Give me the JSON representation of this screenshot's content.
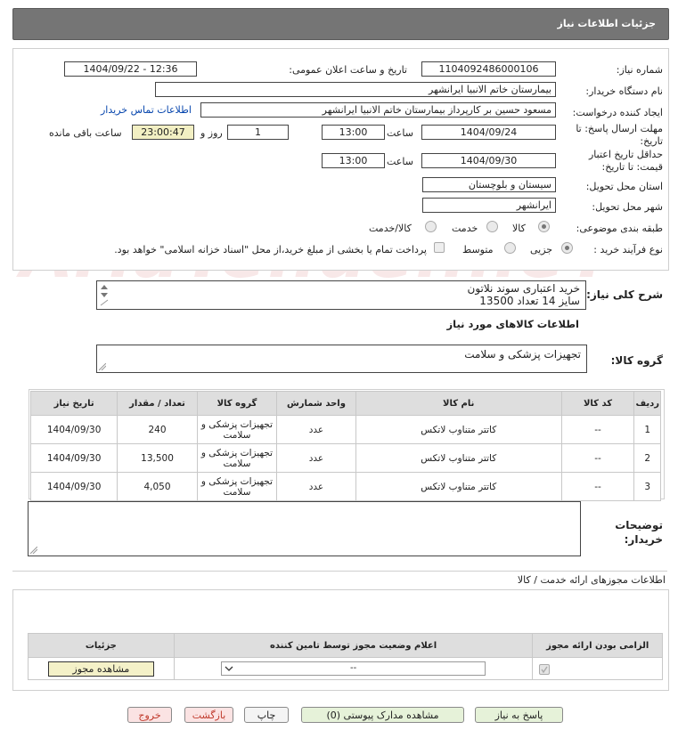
{
  "header": {
    "title": "جزئیات اطلاعات نیاز"
  },
  "form": {
    "need_number_label": "شماره نیاز:",
    "need_number": "1104092486000106",
    "announce_label": "تاریخ و ساعت اعلان عمومی:",
    "announce_value": "1404/09/22 - 12:36",
    "buyer_org_label": "نام دستگاه خریدار:",
    "buyer_org": "بیمارستان خاتم الانبیا ایرانشهر",
    "creator_label": "ایجاد کننده درخواست:",
    "creator": "مسعود حسین بر کارپرداز بیمارستان خاتم الانبیا ایرانشهر",
    "contact_link": "اطلاعات تماس خریدار",
    "deadline_label_1": "مهلت ارسال پاسخ: تا",
    "deadline_label_2": "تاریخ:",
    "deadline_date": "1404/09/24",
    "time_label": "ساعت",
    "deadline_time": "13:00",
    "days_value": "1",
    "days_label": "روز و",
    "remaining_time": "23:00:47",
    "remaining_label": "ساعت باقی مانده",
    "validity_label_1": "حداقل تاریخ اعتبار",
    "validity_label_2": "قیمت: تا تاریخ:",
    "validity_date": "1404/09/30",
    "validity_time": "13:00",
    "province_label": "استان محل تحویل:",
    "province": "سیستان و بلوچستان",
    "city_label": "شهر محل تحویل:",
    "city": "ایرانشهر",
    "category_label": "طبقه بندی موضوعی:",
    "category_options": [
      "کالا",
      "خدمت",
      "کالا/خدمت"
    ],
    "process_label": "نوع فرآیند خرید :",
    "process_options": [
      "جزیی",
      "متوسط"
    ],
    "payment_note": "پرداخت تمام یا بخشی از مبلغ خرید،از محل \"اسناد خزانه اسلامی\" خواهد بود."
  },
  "watermark": "AriaTender.neT",
  "description": {
    "label": "شرح کلی نیاز:",
    "line1": "خرید اعتباری سوند نلاتون",
    "line2": "سایز 14 تعداد 13500"
  },
  "goods": {
    "section_title": "اطلاعات کالاهای مورد نیاز",
    "group_label": "گروه کالا:",
    "group_value": "تجهیزات پزشکی و سلامت",
    "columns": [
      "ردیف",
      "کد کالا",
      "نام کالا",
      "واحد شمارش",
      "گروه کالا",
      "تعداد / مقدار",
      "تاریخ نیاز"
    ],
    "rows": [
      {
        "row": "1",
        "code": "--",
        "name": "کاتتر متناوب لاتکس",
        "unit": "عدد",
        "group": "تجهیزات پزشکی و سلامت",
        "qty": "240",
        "date": "1404/09/30"
      },
      {
        "row": "2",
        "code": "--",
        "name": "کاتتر متناوب لاتکس",
        "unit": "عدد",
        "group": "تجهیزات پزشکی و سلامت",
        "qty": "13,500",
        "date": "1404/09/30"
      },
      {
        "row": "3",
        "code": "--",
        "name": "کاتتر متناوب لاتکس",
        "unit": "عدد",
        "group": "تجهیزات پزشکی و سلامت",
        "qty": "4,050",
        "date": "1404/09/30"
      }
    ]
  },
  "buyer_notes": {
    "label_1": "توضیحات",
    "label_2": "خریدار:",
    "value": ""
  },
  "permits": {
    "section_title": "اطلاعات مجوزهای ارائه خدمت / کالا",
    "columns": [
      "الزامی بودن ارائه مجوز",
      "اعلام وضعیت مجوز توسط تامین کننده",
      "جزئیات"
    ],
    "status_value": "--",
    "view_button": "مشاهده مجوز"
  },
  "footer": {
    "reply": "پاسخ به نیاز",
    "docs": "مشاهده مدارک پیوستی (0)",
    "print": "چاپ",
    "back": "بازگشت",
    "exit": "خروج"
  }
}
